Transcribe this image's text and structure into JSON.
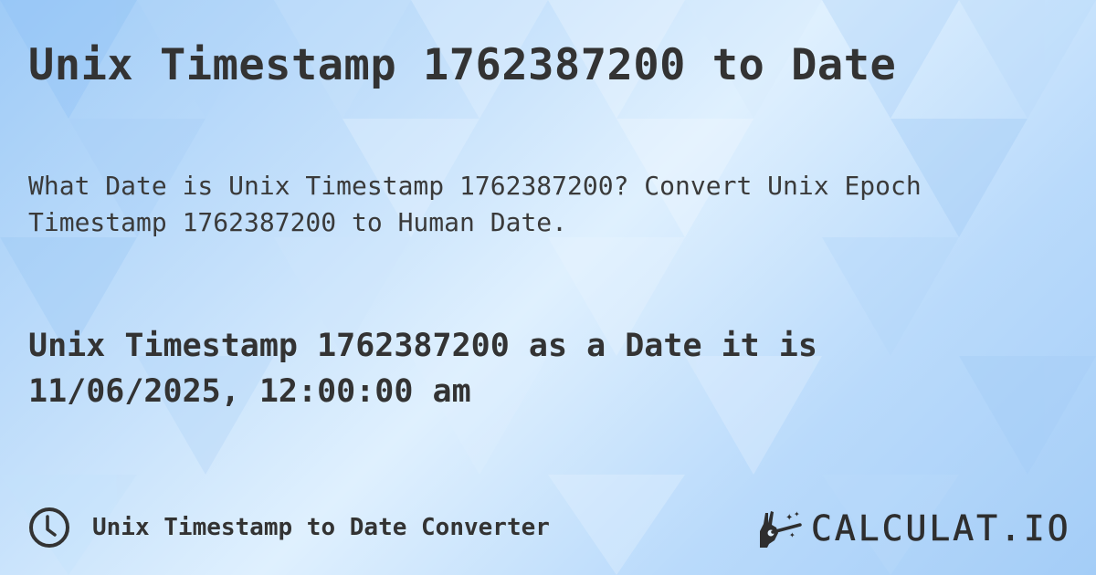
{
  "header": {
    "title": "Unix Timestamp 1762387200 to Date"
  },
  "description": {
    "line1": "What Date is Unix Timestamp 1762387200? Convert Unix Epoch",
    "line2": "Timestamp 1762387200 to Human Date."
  },
  "result": {
    "line1": "Unix Timestamp 1762387200 as a Date it is",
    "line2": "11/06/2025, 12:00:00 am"
  },
  "footer": {
    "icon": "clock-icon",
    "label": "Unix Timestamp to Date Converter",
    "logo_text": "CALCULAT.IO",
    "logo_icon": "magic-hand-icon"
  },
  "colors": {
    "text": "#333333",
    "background_light": "#dff0fe",
    "background_blue": "#9fcbf7"
  }
}
